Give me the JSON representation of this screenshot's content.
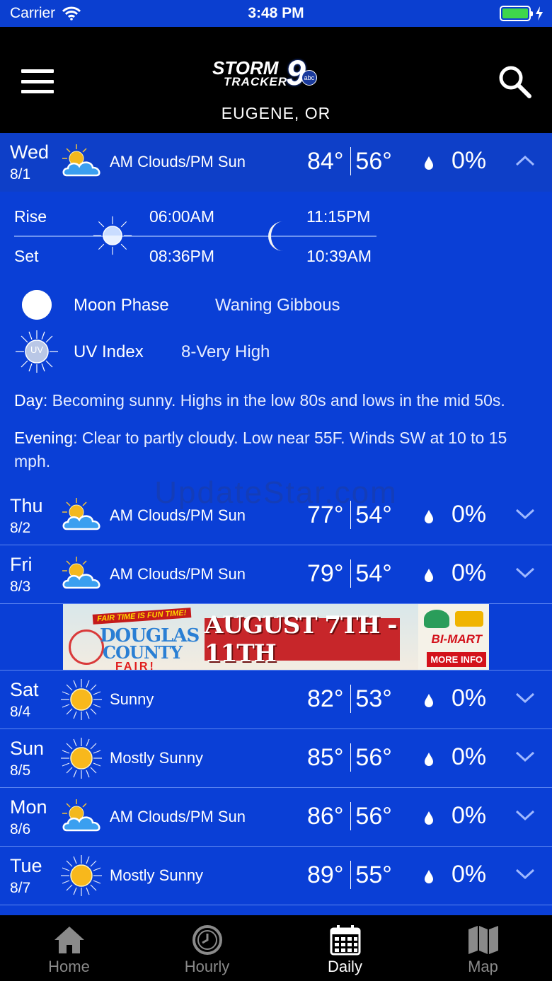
{
  "status_bar": {
    "carrier": "Carrier",
    "time": "3:48 PM"
  },
  "header": {
    "logo": {
      "line1": "STORM",
      "line2": "TRACKER",
      "number": "9",
      "network": "abc"
    },
    "location": "EUGENE, OR"
  },
  "days": [
    {
      "day": "Wed",
      "date": "8/1",
      "condition": "AM Clouds/PM Sun",
      "icon": "partly-cloudy-icon",
      "high": "84°",
      "low": "56°",
      "precip": "0%",
      "expanded": true
    },
    {
      "day": "Thu",
      "date": "8/2",
      "condition": "AM Clouds/PM Sun",
      "icon": "partly-cloudy-icon",
      "high": "77°",
      "low": "54°",
      "precip": "0%"
    },
    {
      "day": "Fri",
      "date": "8/3",
      "condition": "AM Clouds/PM Sun",
      "icon": "partly-cloudy-icon",
      "high": "79°",
      "low": "54°",
      "precip": "0%"
    },
    {
      "day": "Sat",
      "date": "8/4",
      "condition": "Sunny",
      "icon": "sun-icon",
      "high": "82°",
      "low": "53°",
      "precip": "0%"
    },
    {
      "day": "Sun",
      "date": "8/5",
      "condition": "Mostly Sunny",
      "icon": "sun-icon",
      "high": "85°",
      "low": "56°",
      "precip": "0%"
    },
    {
      "day": "Mon",
      "date": "8/6",
      "condition": "AM Clouds/PM Sun",
      "icon": "partly-cloudy-icon",
      "high": "86°",
      "low": "56°",
      "precip": "0%"
    },
    {
      "day": "Tue",
      "date": "8/7",
      "condition": "Mostly Sunny",
      "icon": "sun-icon",
      "high": "89°",
      "low": "55°",
      "precip": "0%"
    }
  ],
  "details": {
    "rise_label": "Rise",
    "set_label": "Set",
    "sunrise": "06:00AM",
    "sunset": "08:36PM",
    "moonrise": "11:15PM",
    "moonset": "10:39AM",
    "moon_phase_label": "Moon Phase",
    "moon_phase_value": "Waning Gibbous",
    "uv_label": "UV Index",
    "uv_icon_text": "UV",
    "uv_value": "8-Very High",
    "day_label": "Day",
    "day_text": ": Becoming sunny. Highs in the low 80s and lows in the mid 50s.",
    "evening_label": "Evening",
    "evening_text": ": Clear to partly cloudy. Low near 55F. Winds SW at 10 to 15 mph."
  },
  "ad": {
    "tagline": "FAIR TIME IS FUN TIME!",
    "line1": "DOUGLAS",
    "line2": "COUNTY",
    "line3": "FAIR!",
    "dates": "AUGUST 7TH - 11TH",
    "brand": "BI-MART",
    "cta": "MORE INFO"
  },
  "watermark": "UpdateStar.com",
  "tabs": [
    {
      "label": "Home",
      "icon": "home-icon",
      "active": false
    },
    {
      "label": "Hourly",
      "icon": "clock-icon",
      "active": false
    },
    {
      "label": "Daily",
      "icon": "calendar-icon",
      "active": true
    },
    {
      "label": "Map",
      "icon": "map-icon",
      "active": false
    }
  ],
  "colors": {
    "background": "#0a3fd6",
    "header": "#000000",
    "divider": "#5d86f0",
    "battery": "#3fd64b"
  }
}
